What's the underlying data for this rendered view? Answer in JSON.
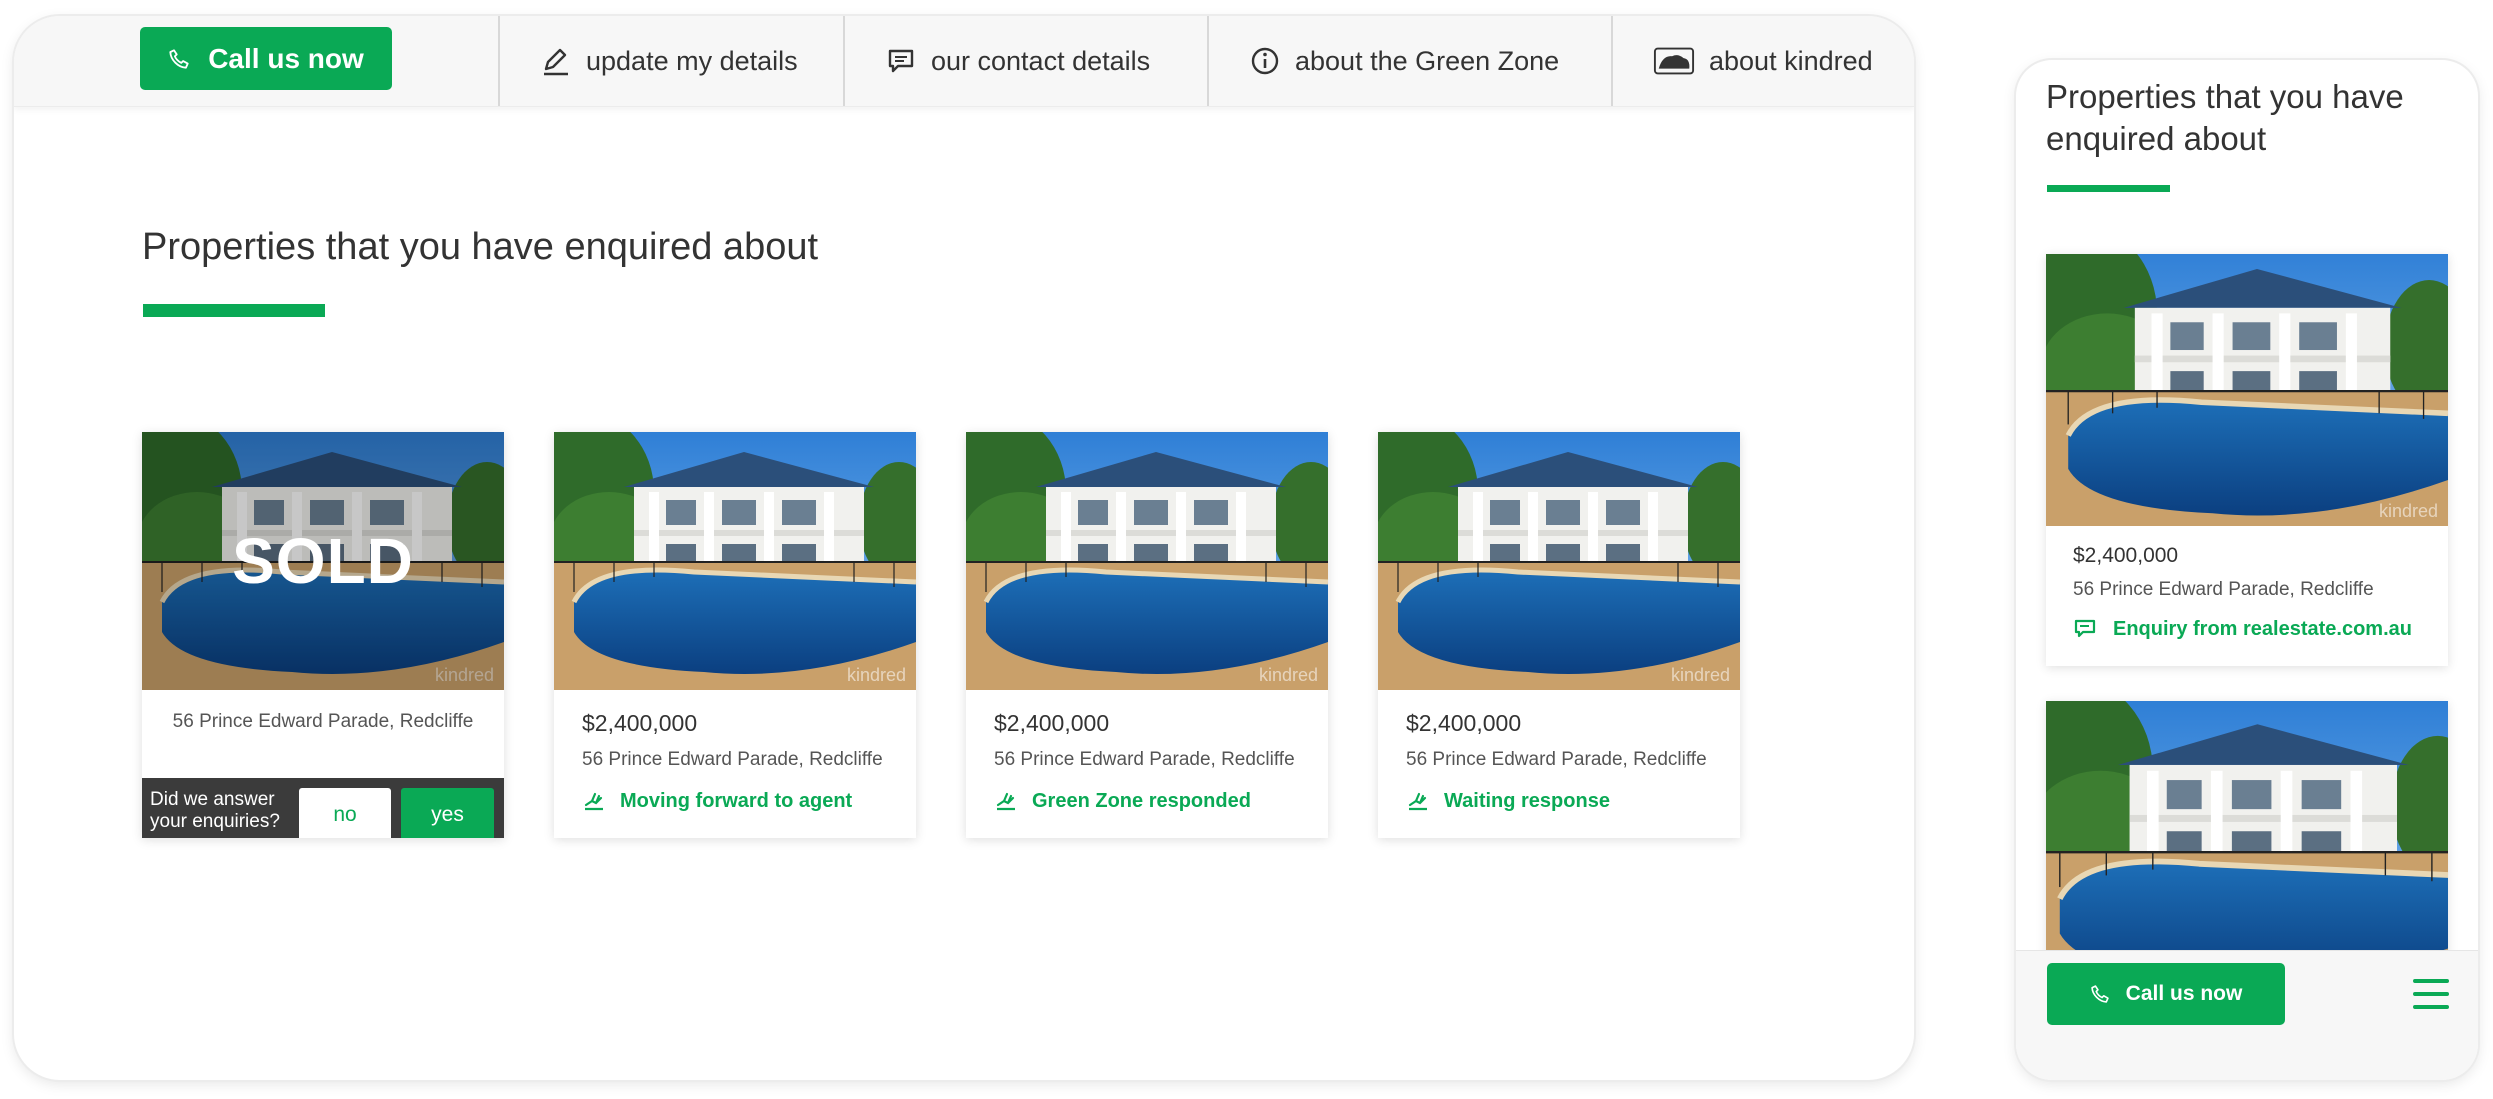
{
  "colors": {
    "accent": "#0aa955",
    "text": "#333333",
    "sold_bar": "#3b3b3b"
  },
  "header": {
    "call_label": "Call us now",
    "nav": [
      {
        "label": "update my details",
        "icon": "pencil-icon"
      },
      {
        "label": "our contact details",
        "icon": "chat-icon"
      },
      {
        "label": "about the Green Zone",
        "icon": "info-icon"
      },
      {
        "label": "about kindred",
        "icon": "kindred-logo-icon"
      }
    ]
  },
  "main": {
    "title": "Properties that you have enquired about",
    "watermark": "kindred",
    "sold_card": {
      "overlay": "SOLD",
      "address": "56 Prince Edward Parade, Redcliffe",
      "question": "Did we answer your enquiries?",
      "no_label": "no",
      "yes_label": "yes"
    },
    "cards": [
      {
        "price": "$2,400,000",
        "address": "56 Prince Edward Parade, Redcliffe",
        "status": "Moving forward to agent"
      },
      {
        "price": "$2,400,000",
        "address": "56 Prince Edward Parade, Redcliffe",
        "status": "Green Zone responded"
      },
      {
        "price": "$2,400,000",
        "address": "56 Prince Edward Parade, Redcliffe",
        "status": "Waiting response"
      }
    ]
  },
  "mobile": {
    "title": "Properties that you have enquired about",
    "card": {
      "price": "$2,400,000",
      "address": "56 Prince Edward Parade, Redcliffe",
      "status": "Enquiry from realestate.com.au"
    },
    "call_label": "Call us now"
  }
}
